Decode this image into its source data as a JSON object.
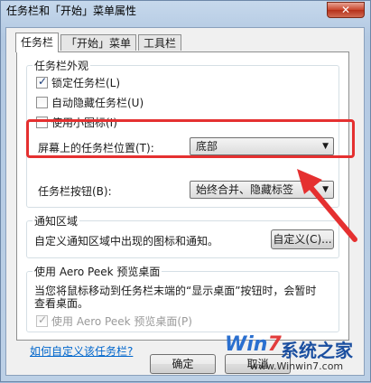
{
  "window": {
    "title": "任务栏和「开始」菜单属性",
    "close_glyph": "✕"
  },
  "tabs": [
    {
      "label": "任务栏"
    },
    {
      "label": "「开始」菜单"
    },
    {
      "label": "工具栏"
    }
  ],
  "appearance": {
    "legend": "任务栏外观",
    "lock": {
      "label": "锁定任务栏(L)",
      "checked": true
    },
    "autohide": {
      "label": "自动隐藏任务栏(U)",
      "checked": false
    },
    "small_icons": {
      "label": "使用小图标(I)",
      "checked": false
    },
    "location_label": "屏幕上的任务栏位置(T):",
    "location_value": "底部",
    "buttons_label": "任务栏按钮(B):",
    "buttons_value": "始终合并、隐藏标签"
  },
  "notification": {
    "legend": "通知区域",
    "text": "自定义通知区域中出现的图标和通知。",
    "customize_button": "自定义(C)..."
  },
  "aero_peek": {
    "legend": "使用 Aero Peek 预览桌面",
    "text_line1": "当您将鼠标移动到任务栏末端的“显示桌面”按钮时，会暂时",
    "text_line2": "查看桌面。",
    "checkbox_label": "使用 Aero Peek 预览桌面(P)",
    "checked": true
  },
  "help_link": "如何自定义该任务栏?",
  "footer": {
    "ok": "确定",
    "cancel": "取消"
  },
  "watermark": {
    "logo_prefix": "Win",
    "logo_seven": "7",
    "site_name": "系统之家",
    "url": "www.Winwin7.com"
  },
  "colors": {
    "highlight": "#e53030",
    "link": "#0066cc"
  }
}
